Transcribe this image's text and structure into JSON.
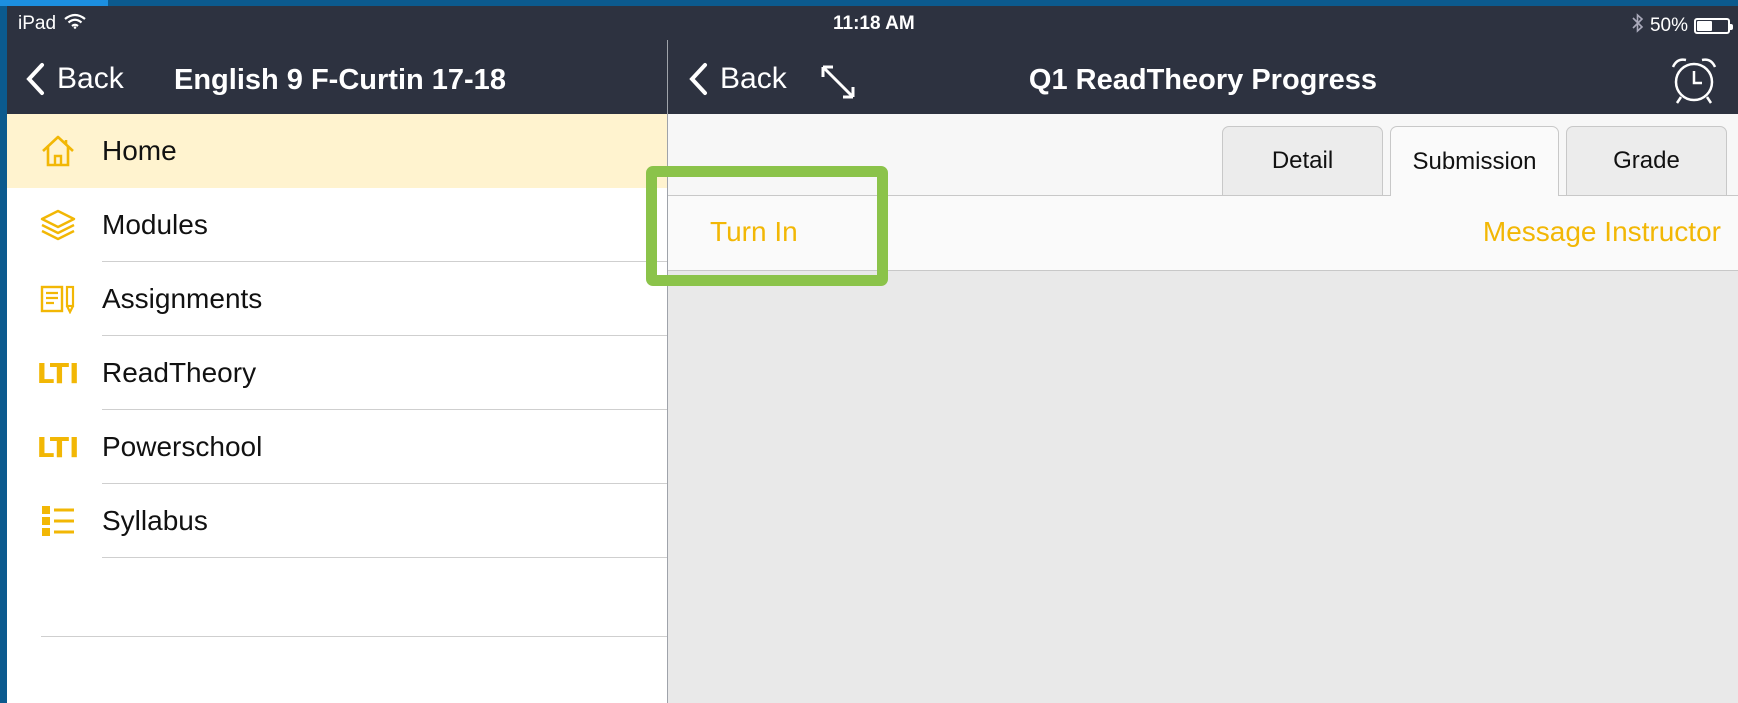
{
  "status_bar": {
    "device": "iPad",
    "time": "11:18 AM",
    "battery": "50%",
    "battery_level": 0.5,
    "icons": [
      "wifi-icon",
      "bluetooth-icon",
      "battery-icon"
    ]
  },
  "left_nav": {
    "back_label": "Back",
    "title": "English 9 F-Curtin 17-18"
  },
  "right_nav": {
    "back_label": "Back",
    "title": "Q1 ReadTheory Progress",
    "icons": [
      "expand-icon",
      "alarm-clock-icon"
    ]
  },
  "sidebar": {
    "items": [
      {
        "label": "Home",
        "icon": "home-icon",
        "active": true
      },
      {
        "label": "Modules",
        "icon": "layers-icon"
      },
      {
        "label": "Assignments",
        "icon": "assignments-icon"
      },
      {
        "label": "ReadTheory",
        "icon": "lti-icon",
        "icon_text": "LTI"
      },
      {
        "label": "Powerschool",
        "icon": "lti-icon",
        "icon_text": "LTI"
      },
      {
        "label": "Syllabus",
        "icon": "list-icon"
      }
    ]
  },
  "tabs": [
    {
      "label": "Detail"
    },
    {
      "label": "Submission",
      "selected": true
    },
    {
      "label": "Grade"
    }
  ],
  "actions": {
    "turn_in": "Turn In",
    "message_instructor": "Message Instructor"
  },
  "colors": {
    "accent": "#f2b705",
    "nav_bg": "#2d3240",
    "highlight": "#8bc34a",
    "active_row": "#fff3cf"
  }
}
